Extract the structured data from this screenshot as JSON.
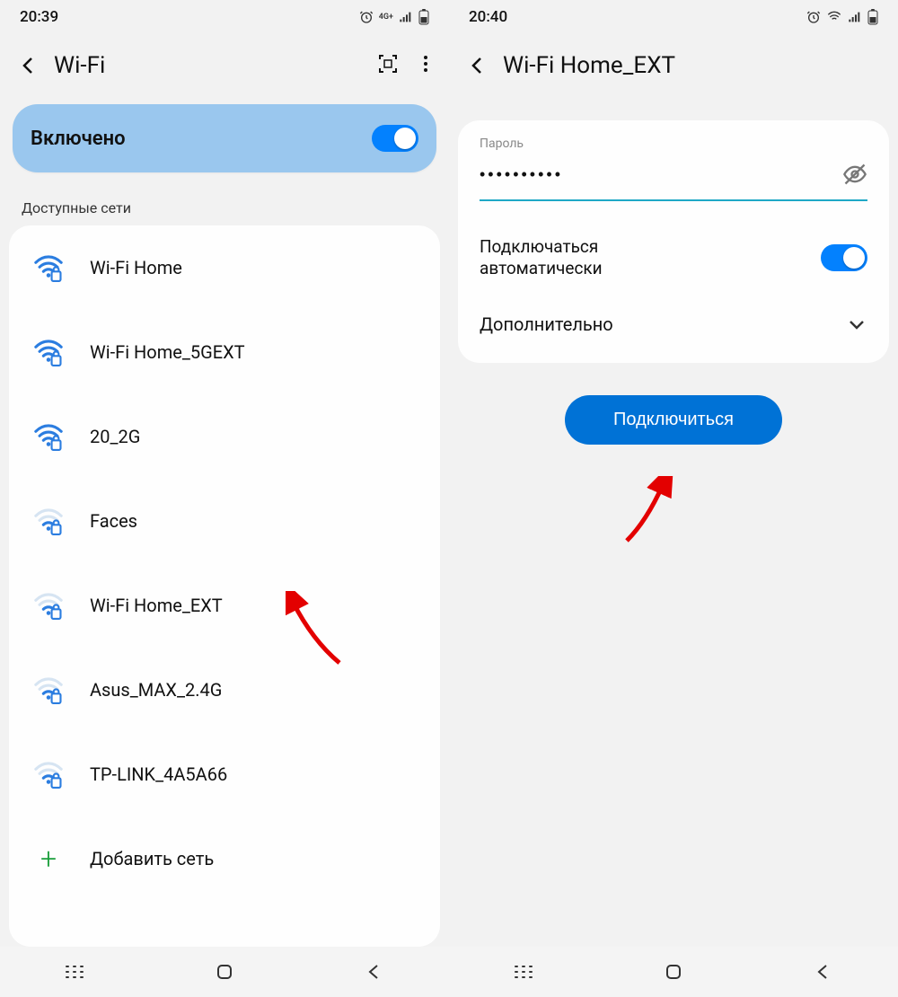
{
  "left": {
    "status": {
      "time": "20:39"
    },
    "header": {
      "title": "Wi-Fi"
    },
    "toggle": {
      "label": "Включено"
    },
    "section_label": "Доступные сети",
    "networks": [
      {
        "name": "Wi-Fi Home",
        "strength": "strong"
      },
      {
        "name": "Wi-Fi Home_5GEXT",
        "strength": "strong"
      },
      {
        "name": "20_2G",
        "strength": "strong"
      },
      {
        "name": "Faces",
        "strength": "weak"
      },
      {
        "name": "Wi-Fi Home_EXT",
        "strength": "weak"
      },
      {
        "name": "Asus_MAX_2.4G",
        "strength": "weak"
      },
      {
        "name": "TP-LINK_4A5A66",
        "strength": "weak"
      }
    ],
    "add_network_label": "Добавить сеть"
  },
  "right": {
    "status": {
      "time": "20:40"
    },
    "header": {
      "title": "Wi-Fi Home_EXT"
    },
    "password": {
      "label": "Пароль",
      "value": "••••••••••"
    },
    "auto_connect_label": "Подключаться автоматически",
    "advanced_label": "Дополнительно",
    "connect_button": "Подключиться"
  }
}
